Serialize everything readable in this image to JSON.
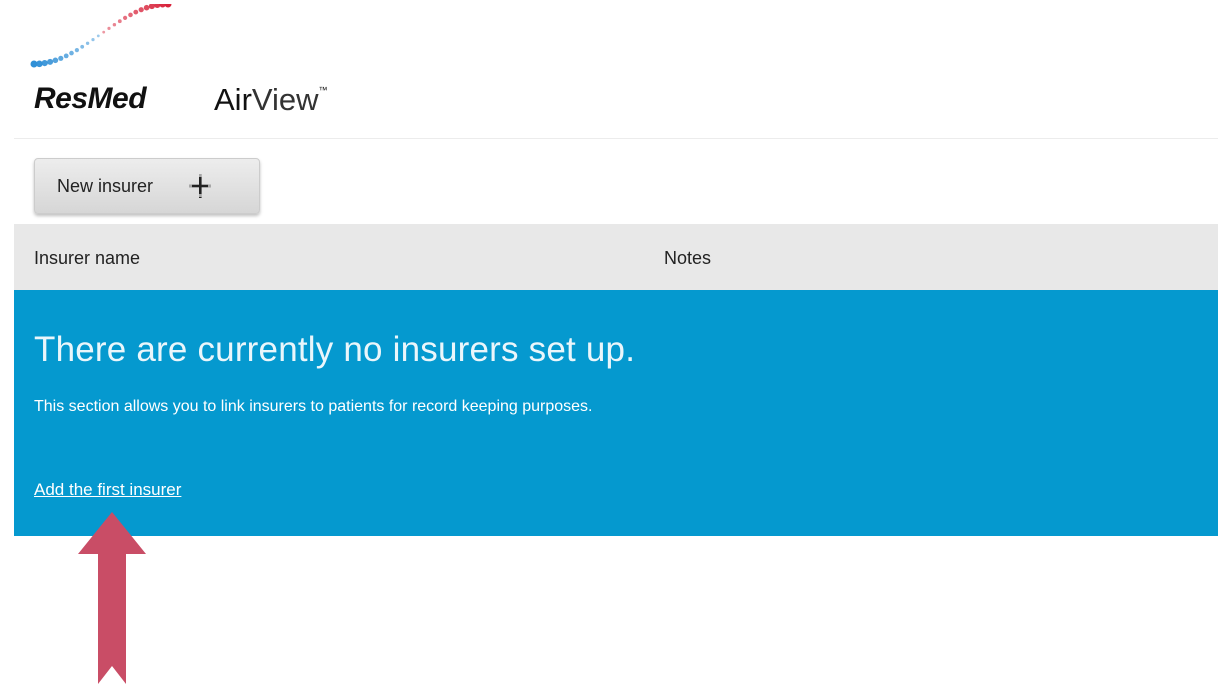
{
  "header": {
    "brand": "ResMed",
    "product_part1": "Air",
    "product_part2": "View",
    "product_tm": "™",
    "logo_icon": "resmed-wave-logo"
  },
  "toolbar": {
    "new_insurer_label": "New insurer",
    "new_insurer_icon": "plus-icon"
  },
  "table": {
    "columns": [
      "Insurer name",
      "Notes"
    ]
  },
  "empty_state": {
    "title": "There are currently no insurers set up.",
    "description": "This section allows you to link insurers to patients for record keeping purposes.",
    "link_label": "Add the first insurer"
  },
  "colors": {
    "panel_blue": "#0599cf",
    "header_gray": "#e8e8e8",
    "arrow_red": "#c94d66",
    "logo_blue": "#2f8fd6",
    "logo_red": "#d8243c"
  },
  "annotation": {
    "icon": "up-arrow-annotation-icon"
  }
}
